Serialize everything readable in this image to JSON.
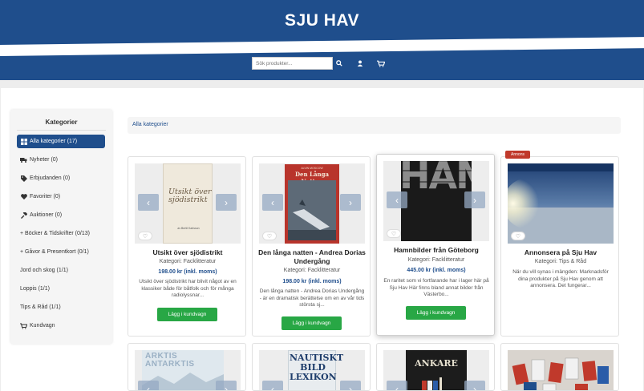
{
  "header": {
    "site_title": "SJU HAV",
    "search_placeholder": "Sök produkter...",
    "search_icon": "search-icon",
    "user_icon": "user-icon",
    "cart_icon": "cart-icon",
    "colors": {
      "brand": "#1f4e8c",
      "buy": "#28a745",
      "badge": "#c0392b"
    }
  },
  "sidebar": {
    "title": "Kategorier",
    "items": [
      {
        "label": "Alla kategorier (17)",
        "icon": "grid-icon",
        "active": true
      },
      {
        "label": "Nyheter (0)",
        "icon": "truck-icon"
      },
      {
        "label": "Erbjudanden (0)",
        "icon": "tag-icon"
      },
      {
        "label": "Favoriter (0)",
        "icon": "heart-icon"
      },
      {
        "label": "Auktioner (0)",
        "icon": "gavel-icon"
      },
      {
        "label": "+ Böcker & Tidskrifter (0/13)",
        "icon": ""
      },
      {
        "label": "+ Gåvor & Presentkort (0/1)",
        "icon": ""
      },
      {
        "label": "Jord och skog (1/1)",
        "icon": ""
      },
      {
        "label": "Loppis (1/1)",
        "icon": ""
      },
      {
        "label": "Tips & Råd (1/1)",
        "icon": ""
      },
      {
        "label": "Kundvagn",
        "icon": "cart-icon"
      }
    ]
  },
  "breadcrumb": {
    "label": "Alla kategorier"
  },
  "products": [
    {
      "name": "Utsikt över sjödistrikt",
      "category": "Kategori: Facklitteratur",
      "price": "198.00 kr (inkl. moms)",
      "desc": "Utsikt över sjödistrikt har blivit något av en klassiker både för båtfolk och för många radiolyssnar...",
      "buy_label": "Lägg i kundvagn",
      "cover_title": "Utsikt över sjödistrikt",
      "cover_author": "av Bertil Karlsson"
    },
    {
      "name": "Den långa natten - Andrea Dorias Undergång",
      "category": "Kategori: Facklitteratur",
      "price": "198.00 kr (inkl. moms)",
      "desc": "Den långa natten - Andrea Dorias Undergång - är en dramatisk berättelse om en av vår tids största sj...",
      "buy_label": "Lägg i kundvagn",
      "cover_title": "Den Långa Natten",
      "cover_author": "ALVIN MOSCOW"
    },
    {
      "name": "Hamnbilder från Göteborg",
      "category": "Kategori: Facklitteratur",
      "price": "445.00 kr (inkl. moms)",
      "desc": "En raritet som vi fortfarande har i lager här på Sju Hav Här finns bland annat bilder från Västerbo...",
      "buy_label": "Lägg i kundvagn",
      "cover_title": "HAMN"
    },
    {
      "name": "Annonsera på Sju Hav",
      "category": "Kategori: Tips & Råd",
      "price": "",
      "desc": "När du vill synas i mängden: Marknadsför dina produkter på Sju Hav genom att annonsera. Det fungerar...",
      "badge": "Annons"
    }
  ],
  "products_row2": [
    {
      "cover_title": "ARKTIS ANTARKTIS"
    },
    {
      "cover_title": "NAUTISKT BILD LEXIKON"
    },
    {
      "cover_title": "ANKARE"
    },
    {
      "cover_title": ""
    }
  ]
}
